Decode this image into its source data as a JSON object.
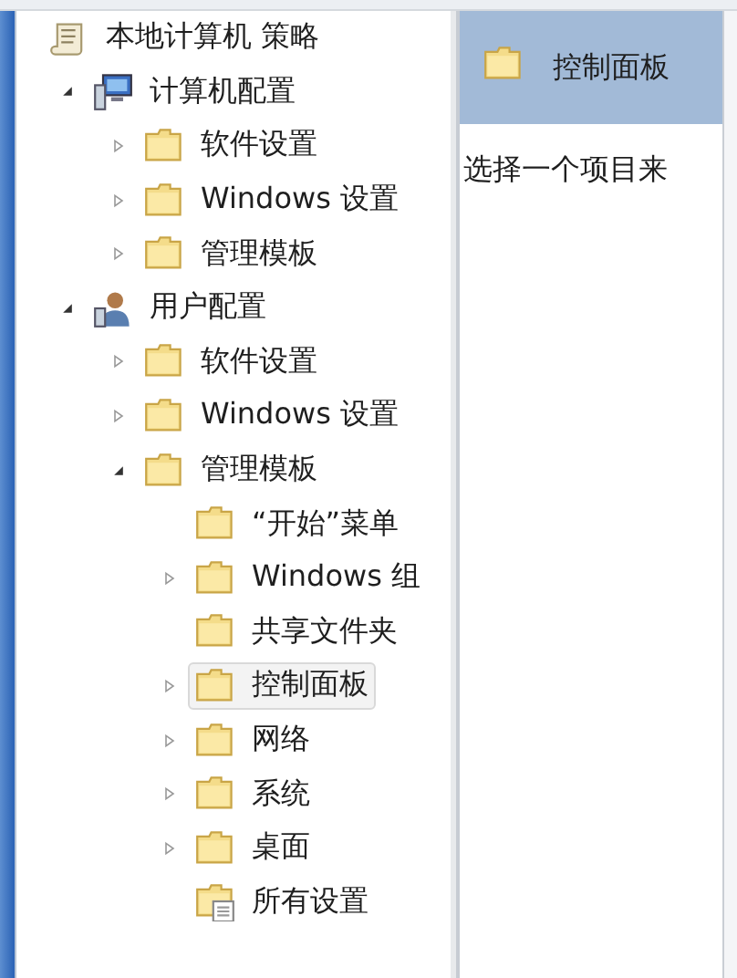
{
  "tree": [
    {
      "label": "本地计算机 策略",
      "kind": "policy",
      "expandable": false,
      "selected": false,
      "children": [
        {
          "label": "计算机配置",
          "kind": "computer",
          "expandable": true,
          "expanded": true,
          "selected": false,
          "children": [
            {
              "label": "软件设置",
              "kind": "folder",
              "expandable": true,
              "expanded": false,
              "selected": false
            },
            {
              "label": "Windows 设置",
              "kind": "folder",
              "expandable": true,
              "expanded": false,
              "selected": false
            },
            {
              "label": "管理模板",
              "kind": "folder",
              "expandable": true,
              "expanded": false,
              "selected": false
            }
          ]
        },
        {
          "label": "用户配置",
          "kind": "user",
          "expandable": true,
          "expanded": true,
          "selected": false,
          "children": [
            {
              "label": "软件设置",
              "kind": "folder",
              "expandable": true,
              "expanded": false,
              "selected": false
            },
            {
              "label": "Windows 设置",
              "kind": "folder",
              "expandable": true,
              "expanded": false,
              "selected": false
            },
            {
              "label": "管理模板",
              "kind": "folder",
              "expandable": true,
              "expanded": true,
              "selected": false,
              "children": [
                {
                  "label": "“开始”菜单",
                  "kind": "folder",
                  "expandable": false,
                  "selected": false
                },
                {
                  "label": "Windows 组",
                  "kind": "folder",
                  "expandable": true,
                  "expanded": false,
                  "selected": false
                },
                {
                  "label": "共享文件夹",
                  "kind": "folder",
                  "expandable": false,
                  "selected": false
                },
                {
                  "label": "控制面板",
                  "kind": "folder",
                  "expandable": true,
                  "expanded": false,
                  "selected": true
                },
                {
                  "label": "网络",
                  "kind": "folder",
                  "expandable": true,
                  "expanded": false,
                  "selected": false
                },
                {
                  "label": "系统",
                  "kind": "folder",
                  "expandable": true,
                  "expanded": false,
                  "selected": false
                },
                {
                  "label": "桌面",
                  "kind": "folder",
                  "expandable": true,
                  "expanded": false,
                  "selected": false
                },
                {
                  "label": "所有设置",
                  "kind": "settings",
                  "expandable": false,
                  "selected": false
                }
              ]
            }
          ]
        }
      ]
    }
  ],
  "details": {
    "title": "控制面板",
    "hint": "选择一个项目来"
  }
}
